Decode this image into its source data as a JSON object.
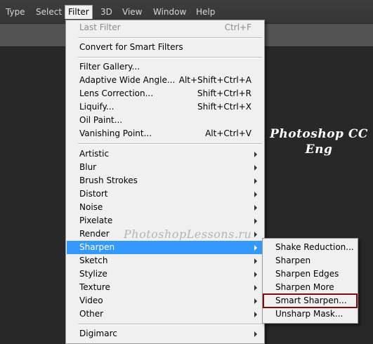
{
  "menubar": {
    "items": [
      "Type",
      "Select",
      "Filter",
      "3D",
      "View",
      "Window",
      "Help"
    ]
  },
  "filter_menu": {
    "last_filter": {
      "label": "Last Filter",
      "shortcut": "Ctrl+F"
    },
    "convert": {
      "label": "Convert for Smart Filters"
    },
    "gallery": {
      "label": "Filter Gallery..."
    },
    "adaptive": {
      "label": "Adaptive Wide Angle...",
      "shortcut": "Alt+Shift+Ctrl+A"
    },
    "lens": {
      "label": "Lens Correction...",
      "shortcut": "Shift+Ctrl+R"
    },
    "liquify": {
      "label": "Liquify...",
      "shortcut": "Shift+Ctrl+X"
    },
    "oil": {
      "label": "Oil Paint..."
    },
    "vanishing": {
      "label": "Vanishing Point...",
      "shortcut": "Alt+Ctrl+V"
    },
    "submenus": [
      "Artistic",
      "Blur",
      "Brush Strokes",
      "Distort",
      "Noise",
      "Pixelate",
      "Render",
      "Sharpen",
      "Sketch",
      "Stylize",
      "Texture",
      "Video",
      "Other"
    ],
    "digimarc": "Digimarc"
  },
  "sharpen_submenu": {
    "items": [
      "Shake Reduction...",
      "Sharpen",
      "Sharpen Edges",
      "Sharpen More",
      "Smart Sharpen...",
      "Unsharp Mask..."
    ]
  },
  "watermark": {
    "title_line1": "Photoshop CC",
    "title_line2": "Eng",
    "site": "PhotoshopLessons.ru"
  },
  "colors": {
    "highlight": "#3399ff",
    "menu_bg": "#f0f0f0",
    "app_bg": "#282828",
    "box_outline": "#7a0e0e"
  }
}
